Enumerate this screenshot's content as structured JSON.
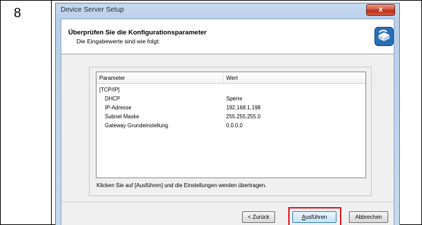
{
  "step": {
    "number": "8"
  },
  "window": {
    "title": "Device Server Setup",
    "close_glyph": "x"
  },
  "header": {
    "title": "Überprüfen Sie die Konfigurationsparameter",
    "subtitle": "Die Eingabewerte sind wie folgt:",
    "icon": "network-device-icon",
    "icon_color": "#2a6db5"
  },
  "listview": {
    "columns": [
      "Parameter",
      "Wert"
    ],
    "rows": [
      {
        "param": "[TCP/IP]",
        "value": ""
      },
      {
        "param": "DHCP",
        "value": "Sperre"
      },
      {
        "param": "IP-Adresse",
        "value": "192.168.1.198"
      },
      {
        "param": "Subnet Maske",
        "value": "255.255.255.0"
      },
      {
        "param": "Gateway Grundeinstellung",
        "value": "0.0.0.0"
      }
    ]
  },
  "hint": "Klicken Sie auf [Ausführen] und die Einstellungen werden übertragen.",
  "buttons": {
    "back": "< Zurück",
    "run": "Ausführen",
    "cancel": "Abbrechen"
  },
  "highlight_color": "#e0141e"
}
